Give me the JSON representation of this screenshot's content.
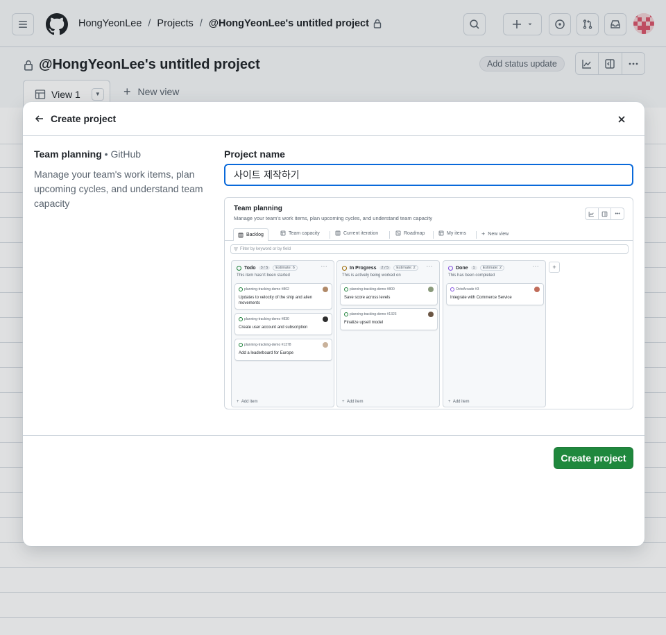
{
  "header": {
    "breadcrumb": {
      "owner": "HongYeonLee",
      "section": "Projects",
      "current": "@HongYeonLee's untitled project"
    }
  },
  "project": {
    "title": "@HongYeonLee's untitled project",
    "status_button": "Add status update",
    "tabs": {
      "view1": "View 1",
      "new_view": "New view"
    }
  },
  "dialog": {
    "title": "Create project",
    "template": {
      "name": "Team planning",
      "source": "GitHub",
      "description": "Manage your team's work items, plan upcoming cycles, and understand team capacity"
    },
    "project_name_label": "Project name",
    "project_name_value": "사이트 제작하기",
    "create_button": "Create project"
  },
  "preview": {
    "title": "Team planning",
    "subtitle": "Manage your team's work items, plan upcoming cycles, and understand team capacity",
    "tabs": [
      "Backlog",
      "Team capacity",
      "Current iteration",
      "Roadmap",
      "My items",
      "New view"
    ],
    "filter_placeholder": "Filter by keyword or by field",
    "columns": [
      {
        "name": "Todo",
        "count": "3 / 5",
        "estimate": "Estimate: 6",
        "description": "This item hasn't been started",
        "color": "#1a7f37",
        "cards": [
          {
            "ref": "planning-tracking-demo #802",
            "title": "Updates to velocity of the ship and alien movements"
          },
          {
            "ref": "planning-tracking-demo #830",
            "title": "Create user account and subscription"
          },
          {
            "ref": "planning-tracking-demo #1378",
            "title": "Add a leaderboard for Europe"
          }
        ],
        "add_label": "Add item"
      },
      {
        "name": "In Progress",
        "count": "2 / 5",
        "estimate": "Estimate: 2",
        "description": "This is actively being worked on",
        "color": "#9a6700",
        "cards": [
          {
            "ref": "planning-tracking-demo #800",
            "title": "Save score across levels"
          },
          {
            "ref": "planning-tracking-demo #1323",
            "title": "Finalize upsell model"
          }
        ],
        "add_label": "Add item"
      },
      {
        "name": "Done",
        "count": "1",
        "estimate": "Estimate: 2",
        "description": "This has been completed",
        "color": "#8250df",
        "cards": [
          {
            "ref": "OctoArcade #3",
            "title": "Integrate with Commerce Service"
          }
        ],
        "add_label": "Add item"
      }
    ]
  }
}
